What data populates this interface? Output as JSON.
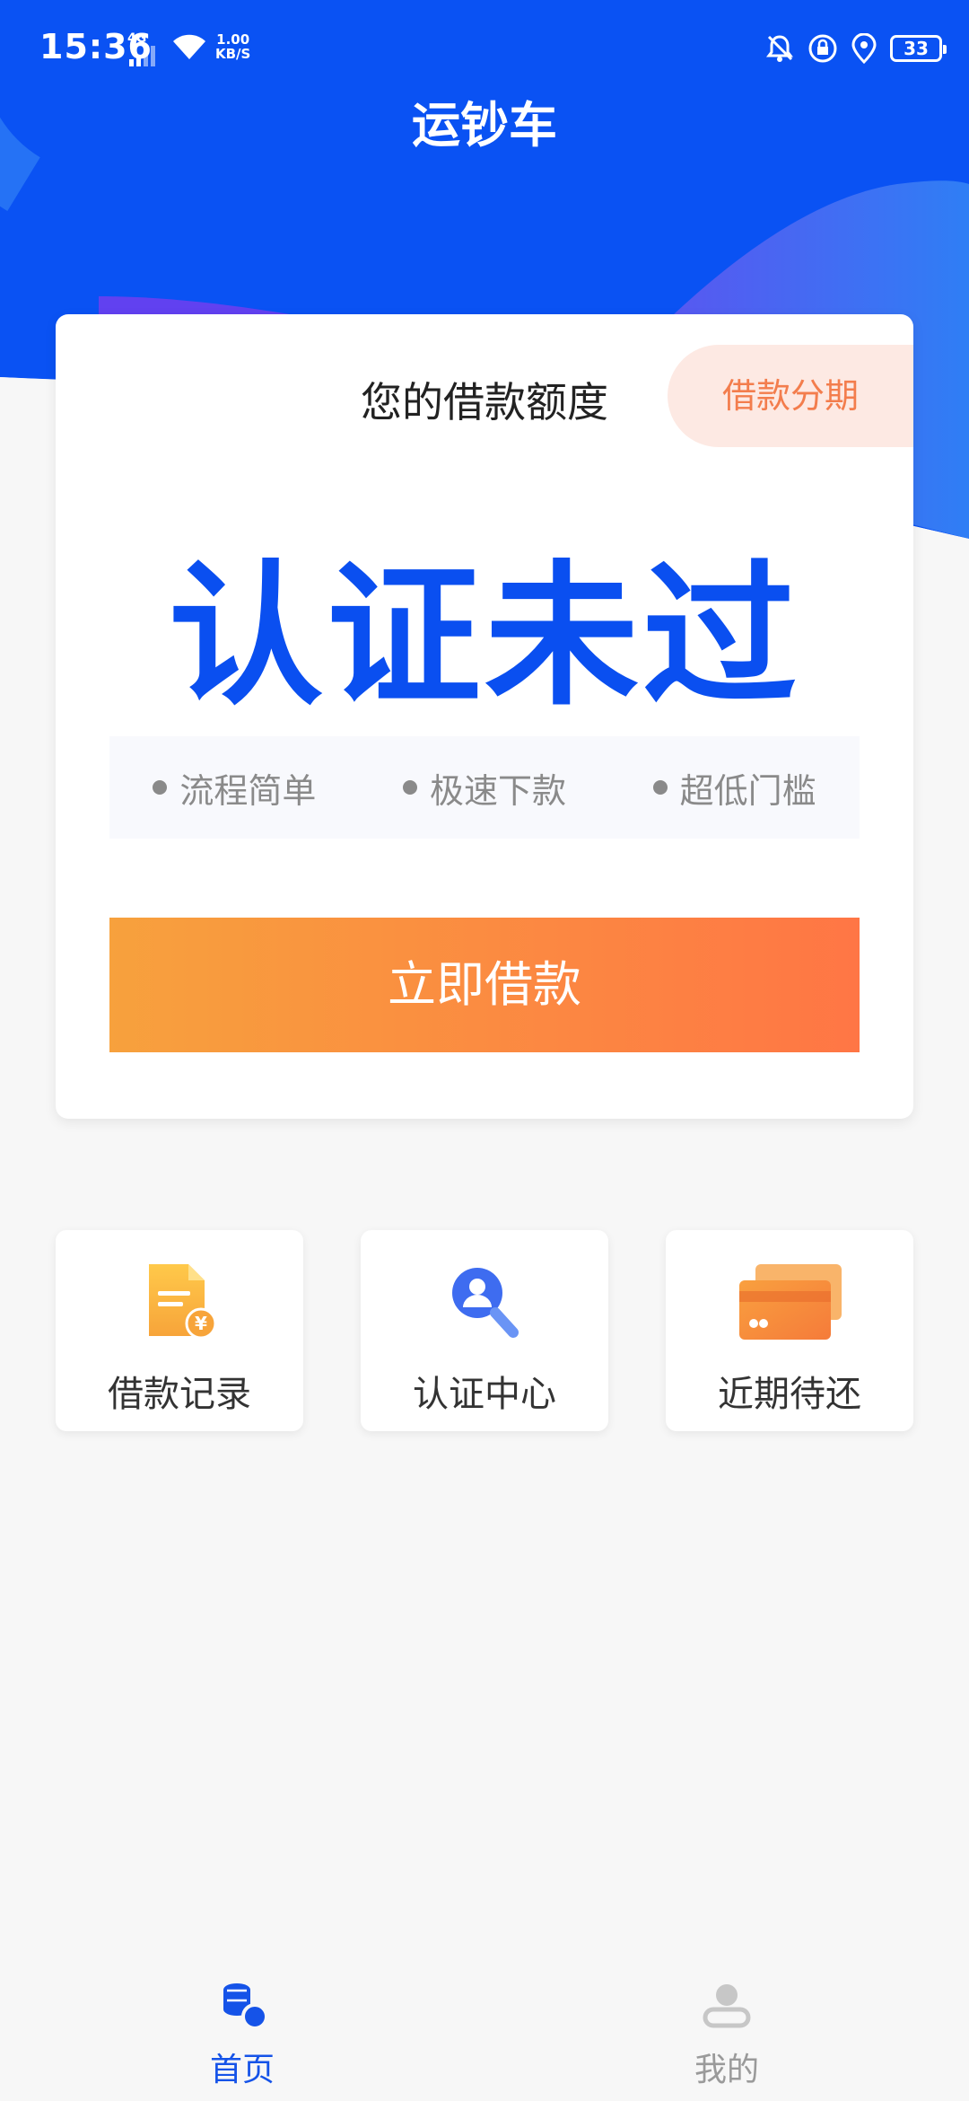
{
  "status_bar": {
    "time": "15:36",
    "network": "4G",
    "speed_value": "1.00",
    "speed_unit": "KB/S",
    "battery": "33"
  },
  "header": {
    "title": "运钞车"
  },
  "loan_card": {
    "label": "您的借款额度",
    "installment_label": "借款分期",
    "status": "认证未过",
    "features": [
      "流程简单",
      "极速下款",
      "超低门槛"
    ],
    "borrow_button": "立即借款"
  },
  "tiles": [
    {
      "label": "借款记录",
      "icon": "loan-record-icon"
    },
    {
      "label": "认证中心",
      "icon": "verification-icon"
    },
    {
      "label": "近期待还",
      "icon": "cards-icon"
    }
  ],
  "bottom_nav": {
    "items": [
      {
        "label": "首页",
        "icon": "home-coins-icon",
        "active": true
      },
      {
        "label": "我的",
        "icon": "user-icon",
        "active": false
      }
    ]
  },
  "colors": {
    "primary_blue": "#0a4ff0",
    "orange_start": "#f7a13d",
    "orange_end": "#ff7645",
    "installment_text": "#f37d4d",
    "installment_bg": "#fde9e3",
    "nav_active": "#1553e8",
    "nav_inactive": "#9a9a9a"
  }
}
